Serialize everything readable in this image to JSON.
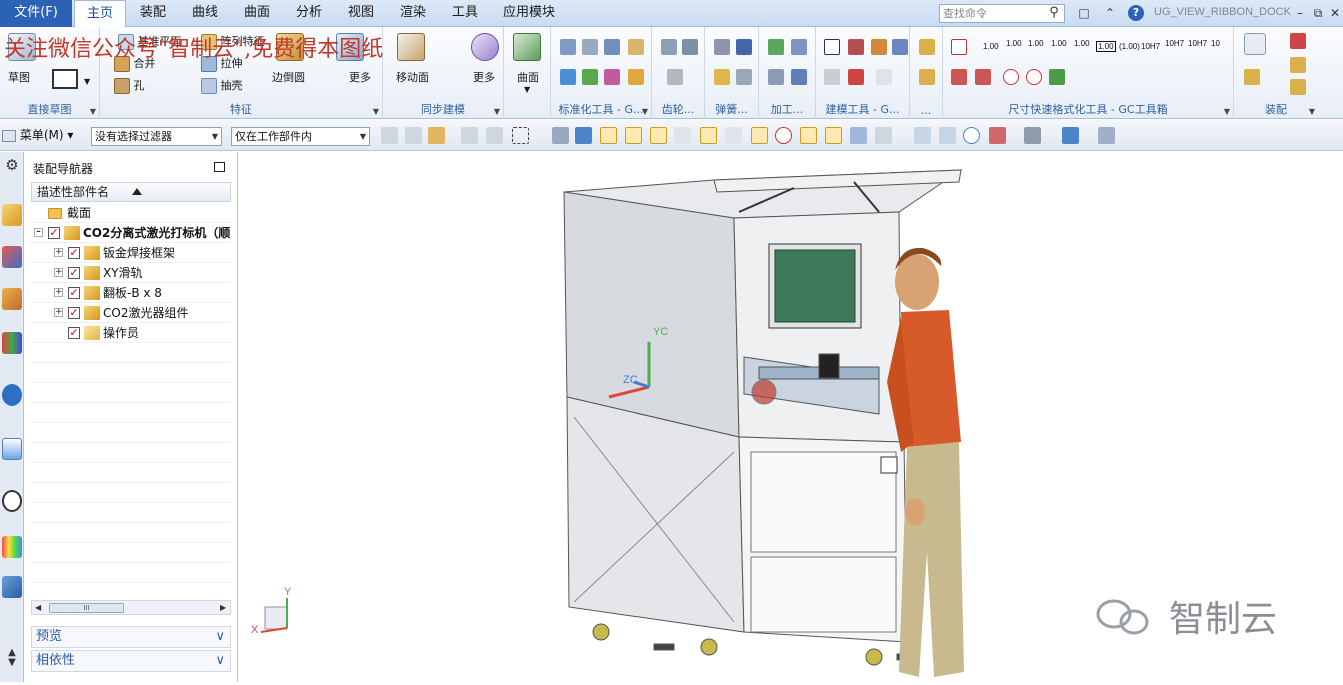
{
  "menubar": {
    "file_tab": "文件(F)",
    "tabs": [
      "主页",
      "装配",
      "曲线",
      "曲面",
      "分析",
      "视图",
      "渲染",
      "工具",
      "应用模块"
    ],
    "active_tab": "主页",
    "search_placeholder": "查找命令",
    "dock_label": "UG_VIEW_RIBBON_DOCK"
  },
  "watermark_top": "关注微信公众号\"智制云\",免费得本图纸",
  "watermark_bottom": "智制云",
  "ribbon": {
    "groups": [
      {
        "label": "直接草图"
      },
      {
        "label": "特征"
      },
      {
        "label": "同步建模"
      },
      {
        "label": ""
      },
      {
        "label": "标准化工具 - G..."
      },
      {
        "label": "齿轮..."
      },
      {
        "label": "弹簧..."
      },
      {
        "label": "加工..."
      },
      {
        "label": "建模工具 - G..."
      },
      {
        "label": "..."
      },
      {
        "label": "尺寸快速格式化工具 - GC工具箱"
      },
      {
        "label": "装配"
      }
    ],
    "buttons": {
      "sketch": "草图",
      "datum_plane": "基准平面",
      "pattern_feature": "阵列特征",
      "extrude": "拉伸",
      "merge": "合并",
      "hole": "孔",
      "shell": "抽壳",
      "edge_blend": "边倒圆",
      "more1": "更多",
      "move_face": "移动面",
      "more2": "更多",
      "surface": "曲面"
    },
    "dimension_labels": [
      "1.00",
      "1.00",
      "1.00",
      "1.00",
      "1.00",
      "1.00",
      "(1.00)",
      "10H7",
      "10H7",
      "10H7",
      "10"
    ]
  },
  "toolbar2": {
    "menu": "菜单(M)",
    "filter": "没有选择过滤器",
    "scope": "仅在工作部件内"
  },
  "navigator": {
    "title": "装配导航器",
    "column_header": "描述性部件名",
    "nodes": [
      {
        "label": "截面",
        "level": 0
      },
      {
        "label": "CO2分离式激光打标机（顺",
        "level": 0
      },
      {
        "label": "钣金焊接框架",
        "level": 1
      },
      {
        "label": "XY滑轨",
        "level": 1
      },
      {
        "label": "翻板-B x 8",
        "level": 1
      },
      {
        "label": "CO2激光器组件",
        "level": 1
      },
      {
        "label": "操作员",
        "level": 1
      }
    ],
    "scroll_thumb": "III",
    "panels": [
      "预览",
      "相依性"
    ]
  },
  "viewport": {
    "wcs_labels": {
      "yc": "YC",
      "zc": "ZC"
    },
    "triad_labels": {
      "y": "Y",
      "x": "X"
    }
  },
  "colors": {
    "file_tab": "#2b62b6",
    "accent": "#2f5f9e",
    "check": "#d00000",
    "operator_shirt": "#d65a2a",
    "operator_pants": "#c8b98e",
    "machine_frame": "#dfe2e6",
    "monitor": "#3d7a5a"
  }
}
